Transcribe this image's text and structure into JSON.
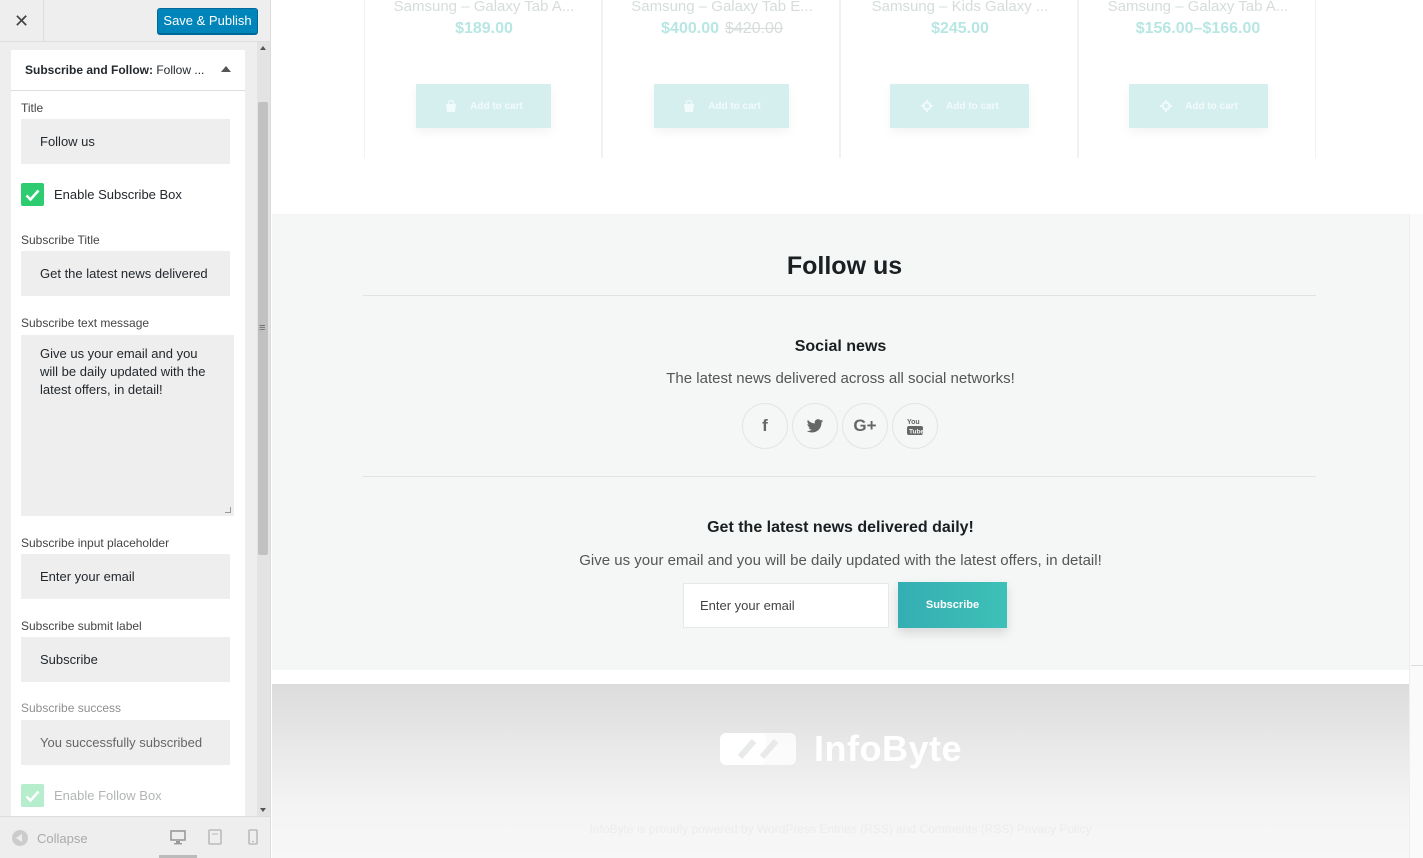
{
  "customizer": {
    "close_icon": "close-icon",
    "publish_label": "Save & Publish",
    "section": {
      "title_bold": "Subscribe and Follow:",
      "title_rest": " Follow ..."
    },
    "controls": {
      "title_label": "Title",
      "title_value": "Follow us",
      "enable_subscribe_label": "Enable Subscribe Box",
      "enable_subscribe_checked": true,
      "subscribe_title_label": "Subscribe Title",
      "subscribe_title_value": "Get the latest news delivered",
      "subscribe_text_label": "Subscribe text message",
      "subscribe_text_value": "Give us your email and you will be daily updated with the latest offers, in detail!",
      "placeholder_label": "Subscribe input placeholder",
      "placeholder_value": "Enter your email",
      "submit_label_label": "Subscribe submit label",
      "submit_label_value": "Subscribe",
      "success_label": "Subscribe success",
      "success_value": "You successfully subscribed",
      "enable_follow_label": "Enable Follow Box",
      "enable_follow_checked": true
    },
    "footer": {
      "collapse_label": "Collapse",
      "devices": [
        "desktop-icon",
        "tablet-icon",
        "mobile-icon"
      ]
    }
  },
  "preview": {
    "products": [
      {
        "name": "Samsung – Galaxy Tab A...",
        "price": "$189.00",
        "old_price": "",
        "button": "Add to cart",
        "button_icon": "bag-icon"
      },
      {
        "name": "Samsung – Galaxy Tab E...",
        "price": "$400.00",
        "old_price": "$420.00",
        "button": "Add to cart",
        "button_icon": "bag-icon"
      },
      {
        "name": "Samsung – Kids Galaxy ...",
        "price": "$245.00",
        "old_price": "",
        "button": "Add to cart",
        "button_icon": "gear-icon"
      },
      {
        "name": "Samsung – Galaxy Tab A...",
        "price": "$156.00–$166.00",
        "old_price": "",
        "button": "Add to cart",
        "button_icon": "gear-icon"
      }
    ],
    "follow": {
      "title": "Follow us",
      "social_title": "Social news",
      "social_subtitle": "The latest news delivered across all social networks!",
      "social_icons": [
        "facebook-icon",
        "twitter-icon",
        "google-plus-icon",
        "youtube-icon"
      ],
      "subscribe_title": "Get the latest news delivered daily!",
      "subscribe_message": "Give us your email and you will be daily updated with the latest offers, in detail!",
      "input_placeholder": "Enter your email",
      "submit_label": "Subscribe"
    },
    "footer": {
      "logo_text": "InfoByte",
      "credits": "InfoByte is proudly powered by WordPress Entries (RSS) and Comments (RSS) Privacy Policy"
    }
  },
  "colors": {
    "publish": "#0085ba",
    "checkbox": "#2ecc71",
    "accent": "#37b6b3",
    "price": "#b7e6e3"
  }
}
